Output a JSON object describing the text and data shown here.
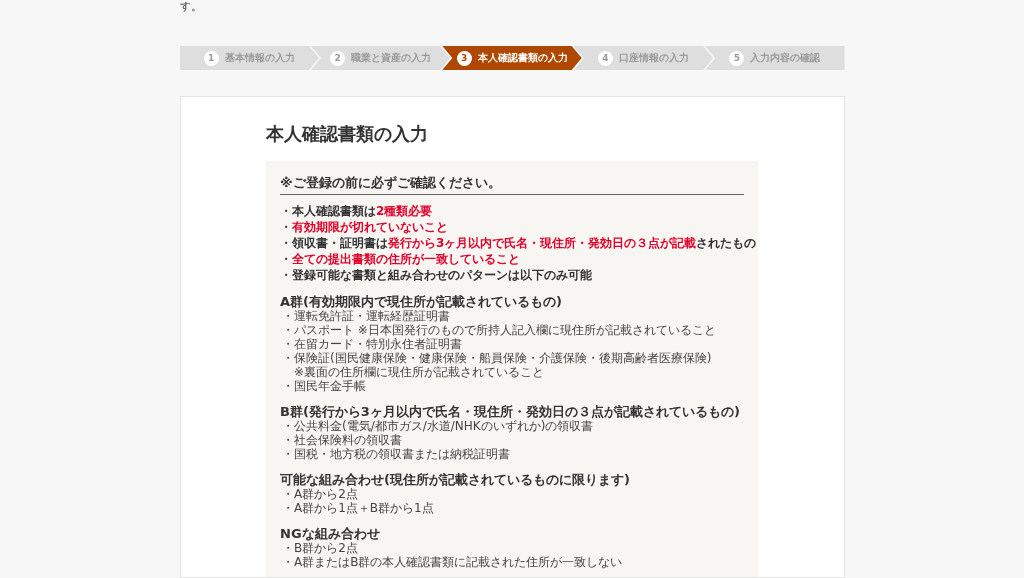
{
  "intro_text": "す。",
  "steps": [
    {
      "number": "1",
      "label": "基本情報の入力",
      "selected": false
    },
    {
      "number": "2",
      "label": "職業と資産の入力",
      "selected": false
    },
    {
      "number": "3",
      "label": "本人確認書類の入力",
      "selected": true
    },
    {
      "number": "4",
      "label": "口座情報の入力",
      "selected": false
    },
    {
      "number": "5",
      "label": "入力内容の確認",
      "selected": false
    }
  ],
  "page_title": "本人確認書類の入力",
  "notice": {
    "heading": "※ご登録の前に必ずご確認ください。",
    "points": [
      {
        "marker": "・",
        "parts": [
          {
            "text": "本人確認書類は",
            "highlight": false
          },
          {
            "text": "2種類必要",
            "highlight": true
          }
        ]
      },
      {
        "marker": "・",
        "parts": [
          {
            "text": "有効期限が切れていないこと",
            "highlight": true
          }
        ]
      },
      {
        "marker": "・",
        "parts": [
          {
            "text": "領収書・証明書は",
            "highlight": false
          },
          {
            "text": "発行から3ヶ月以内で氏名・現住所・発効日の３点が記載",
            "highlight": true
          },
          {
            "text": "されたもの",
            "highlight": false
          }
        ]
      },
      {
        "marker": "・",
        "parts": [
          {
            "text": "全ての提出書類の住所が一致していること",
            "highlight": true
          }
        ]
      },
      {
        "marker": "・",
        "parts": [
          {
            "text": "登録可能な書類と組み合わせのパターンは以下のみ可能",
            "highlight": false
          }
        ]
      }
    ]
  },
  "groups": [
    {
      "heading": "A群(有効期限内で現住所が記載されているもの)",
      "items": [
        {
          "marker": "・",
          "text": "運転免許証・運転経歴証明書"
        },
        {
          "marker": "・",
          "text": "パスポート ※日本国発行のもので所持人記入欄に現住所が記載されていること"
        },
        {
          "marker": "・",
          "text": "在留カード・特別永住者証明書"
        },
        {
          "marker": "・",
          "text": "保険証(国民健康保険・健康保険・船員保険・介護保険・後期高齢者医療保険)",
          "note": "※裏面の住所欄に現住所が記載されていること"
        },
        {
          "marker": "・",
          "text": "国民年金手帳"
        }
      ]
    },
    {
      "heading": "B群(発行から3ヶ月以内で氏名・現住所・発効日の３点が記載されているもの)",
      "items": [
        {
          "marker": "・",
          "text": "公共料金(電気/都市ガス/水道/NHKのいずれか)の領収書"
        },
        {
          "marker": "・",
          "text": "社会保険料の領収書"
        },
        {
          "marker": "・",
          "text": "国税・地方税の領収書または納税証明書"
        }
      ]
    },
    {
      "heading": "可能な組み合わせ(現住所が記載されているものに限ります)",
      "items": [
        {
          "marker": "・",
          "text": "A群から2点"
        },
        {
          "marker": "・",
          "text": "A群から1点＋B群から1点"
        }
      ]
    },
    {
      "heading": "NGな組み合わせ",
      "items": [
        {
          "marker": "・",
          "text": "B群から2点"
        },
        {
          "marker": "・",
          "text": "A群またはB群の本人確認書類に記載された住所が一致しない"
        }
      ]
    }
  ]
}
